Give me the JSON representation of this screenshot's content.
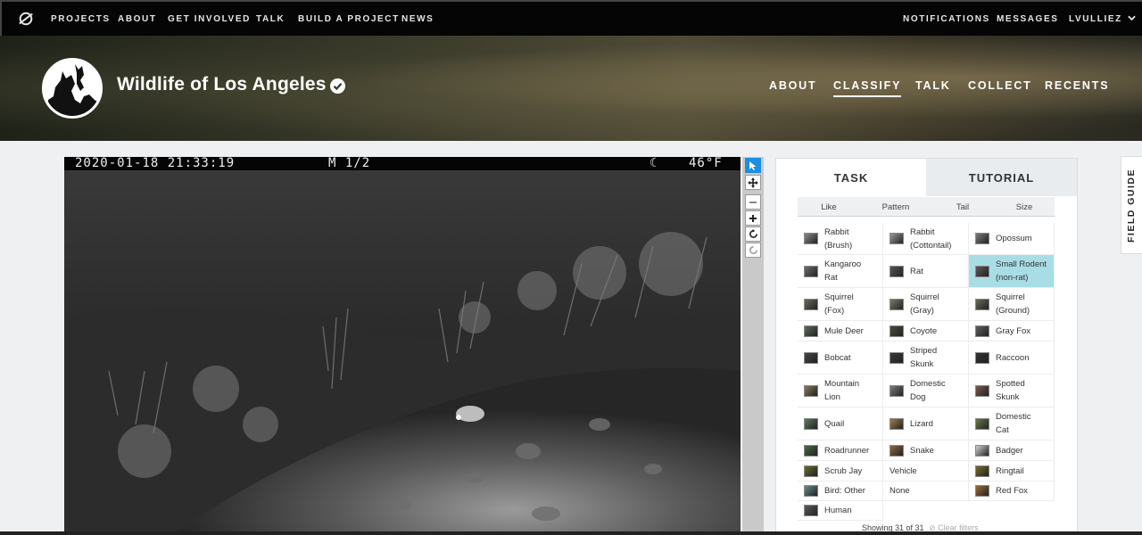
{
  "topnav": {
    "items": [
      "PROJECTS",
      "ABOUT",
      "GET INVOLVED",
      "TALK",
      "BUILD A PROJECT",
      "NEWS"
    ],
    "right": [
      "NOTIFICATIONS",
      "MESSAGES",
      "LVULLIEZ"
    ]
  },
  "project": {
    "title": "Wildlife of Los Angeles",
    "nav": [
      "ABOUT",
      "CLASSIFY",
      "TALK",
      "COLLECT",
      "RECENTS"
    ],
    "active_nav": "CLASSIFY"
  },
  "subject": {
    "datetime": "2020-01-18 21:33:19",
    "frame": "M 1/2",
    "temperature": "46°F"
  },
  "panel": {
    "tabs": [
      "TASK",
      "TUTORIAL"
    ],
    "filters": [
      "Like",
      "Pattern",
      "Tail",
      "Size"
    ],
    "choices": [
      "Rabbit\n(Brush)",
      "Rabbit\n(Cottontail)",
      "Opossum",
      "Kangaroo\nRat",
      "Rat",
      "Small Rodent\n(non-rat)",
      "Squirrel\n(Fox)",
      "Squirrel\n(Gray)",
      "Squirrel\n(Ground)",
      "Mule Deer",
      "Coyote",
      "Gray Fox",
      "Bobcat",
      "Striped\nSkunk",
      "Raccoon",
      "Mountain\nLion",
      "Domestic\nDog",
      "Spotted\nSkunk",
      "Quail",
      "Lizard",
      "Domestic\nCat",
      "Roadrunner",
      "Snake",
      "Badger",
      "Scrub Jay",
      "Vehicle",
      "Ringtail",
      "Bird: Other",
      "None",
      "Red Fox",
      "Human"
    ],
    "selected_choice": "Small Rodent (non-rat)",
    "showing": "Showing 31 of 31",
    "clear_filters": "Clear filters"
  },
  "field_guide": "FIELD GUIDE",
  "colors": {
    "selected": "#a8dde6",
    "active_tool": "#1d8fe0"
  }
}
